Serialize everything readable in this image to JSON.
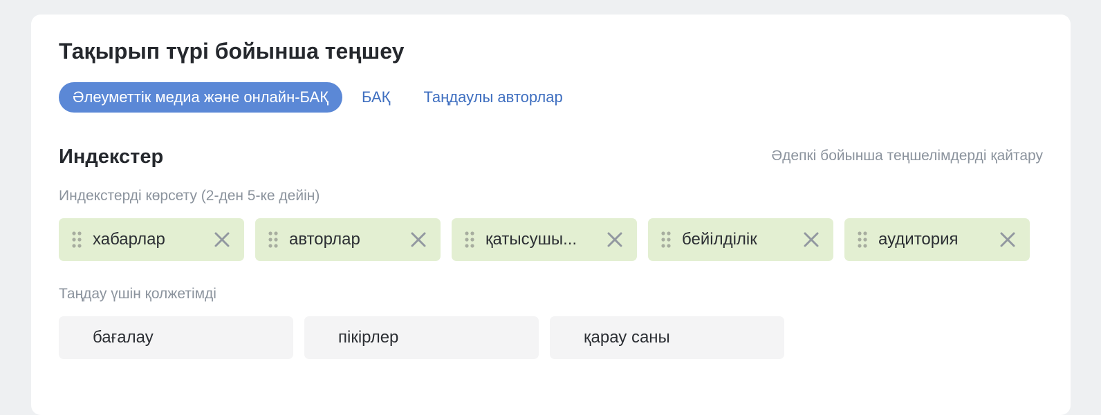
{
  "card": {
    "title": "Тақырып түрі бойынша теңшеу"
  },
  "tabs": [
    {
      "label": "Әлеуметтік медиа және онлайн-БАҚ",
      "active": true
    },
    {
      "label": "БАҚ",
      "active": false
    },
    {
      "label": "Таңдаулы авторлар",
      "active": false
    }
  ],
  "indices": {
    "title": "Индекстер",
    "reset_label": "Әдепкі бойынша теңшелімдерді қайтару",
    "selected_label": "Индекстерді көрсету (2-ден 5-ке дейін)",
    "available_label": "Таңдау үшін қолжетімді",
    "selected": [
      {
        "label": "хабарлар"
      },
      {
        "label": "авторлар"
      },
      {
        "label": "қатысушы..."
      },
      {
        "label": "бейілділік"
      },
      {
        "label": "аудитория"
      }
    ],
    "available": [
      {
        "label": "бағалау"
      },
      {
        "label": "пікірлер"
      },
      {
        "label": "қарау саны"
      }
    ]
  },
  "icons": {
    "drag": "drag-handle-icon",
    "remove": "close-icon"
  },
  "colors": {
    "accent": "#5b88d6",
    "link": "#3f6fc0",
    "selected_chip_bg": "#e3efd2",
    "available_chip_bg": "#f4f4f5",
    "muted_text": "#8b939d"
  }
}
